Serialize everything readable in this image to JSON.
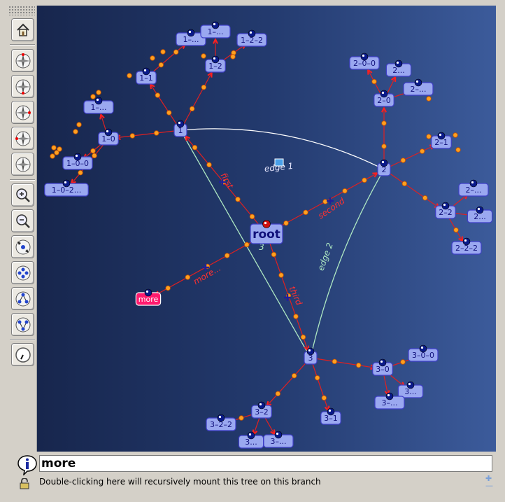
{
  "toolbar": {
    "buttons": [
      {
        "id": "home",
        "icon": "home-icon"
      },
      {
        "id": "compass-1",
        "icon": "compass-icon"
      },
      {
        "id": "compass-2",
        "icon": "compass-icon"
      },
      {
        "id": "compass-3",
        "icon": "compass-icon"
      },
      {
        "id": "compass-4",
        "icon": "compass-icon"
      },
      {
        "id": "compass-5",
        "icon": "compass-icon"
      },
      {
        "id": "zoom-in",
        "icon": "zoom-in-icon"
      },
      {
        "id": "zoom-out",
        "icon": "zoom-out-icon"
      },
      {
        "id": "expand",
        "icon": "expand-arrows-icon"
      },
      {
        "id": "collapse",
        "icon": "collapse-arrows-icon"
      },
      {
        "id": "tree-down",
        "icon": "tree-down-icon"
      },
      {
        "id": "tree-up",
        "icon": "tree-up-icon"
      },
      {
        "id": "clock",
        "icon": "clock-icon"
      }
    ]
  },
  "graph": {
    "nodes": [
      {
        "id": "root",
        "label": "root",
        "big": true
      },
      {
        "id": "more",
        "label": "more",
        "highlight": true
      },
      {
        "id": "n1",
        "label": "1"
      },
      {
        "id": "n2",
        "label": "2"
      },
      {
        "id": "n3",
        "label": "3"
      },
      {
        "id": "n1-0",
        "label": "1–0"
      },
      {
        "id": "n1-1",
        "label": "1–1"
      },
      {
        "id": "n1-2",
        "label": "1–2"
      },
      {
        "id": "n1-0-0",
        "label": "1–0–0"
      },
      {
        "id": "n1-0-2",
        "label": "1–0–2..."
      },
      {
        "id": "n1-0b",
        "label": "1–..."
      },
      {
        "id": "n1-1a",
        "label": "1–..."
      },
      {
        "id": "n1-2a",
        "label": "1–..."
      },
      {
        "id": "n1-2-2",
        "label": "1–2–2"
      },
      {
        "id": "n2-0",
        "label": "2–0"
      },
      {
        "id": "n2-0-0",
        "label": "2–0–0"
      },
      {
        "id": "n2-0a",
        "label": "2..."
      },
      {
        "id": "n2-0b",
        "label": "2–..."
      },
      {
        "id": "n2-1",
        "label": "2–1"
      },
      {
        "id": "n2-2",
        "label": "2–2"
      },
      {
        "id": "n2-2a",
        "label": "2–..."
      },
      {
        "id": "n2-2b",
        "label": "2..."
      },
      {
        "id": "n2-2-2",
        "label": "2–2–2"
      },
      {
        "id": "n3-0",
        "label": "3–0"
      },
      {
        "id": "n3-0-0",
        "label": "3–0–0"
      },
      {
        "id": "n3-0a",
        "label": "3..."
      },
      {
        "id": "n3-0b",
        "label": "3–..."
      },
      {
        "id": "n3-1",
        "label": "3–1"
      },
      {
        "id": "n3-2",
        "label": "3–2"
      },
      {
        "id": "n3-2-2",
        "label": "3–2–2"
      },
      {
        "id": "n3-2a",
        "label": "3..."
      },
      {
        "id": "n3-2b",
        "label": "3–..."
      }
    ],
    "edge_labels": {
      "edge1": "edge 1",
      "edge2": "edge 2",
      "first": "first",
      "second": "second",
      "third": "third",
      "more": "more...",
      "three": "3"
    },
    "colors": {
      "node_fill": "#9aa8f0",
      "node_border": "#3f3fc8",
      "highlight_fill": "#ff1a6e",
      "tree_edge": "#e02020",
      "cross_edge_light": "#aee8c2",
      "cross_edge_white": "#ffffff"
    }
  },
  "status": {
    "title": "more",
    "description": "Double-clicking here will recursively mount this tree on this branch"
  }
}
